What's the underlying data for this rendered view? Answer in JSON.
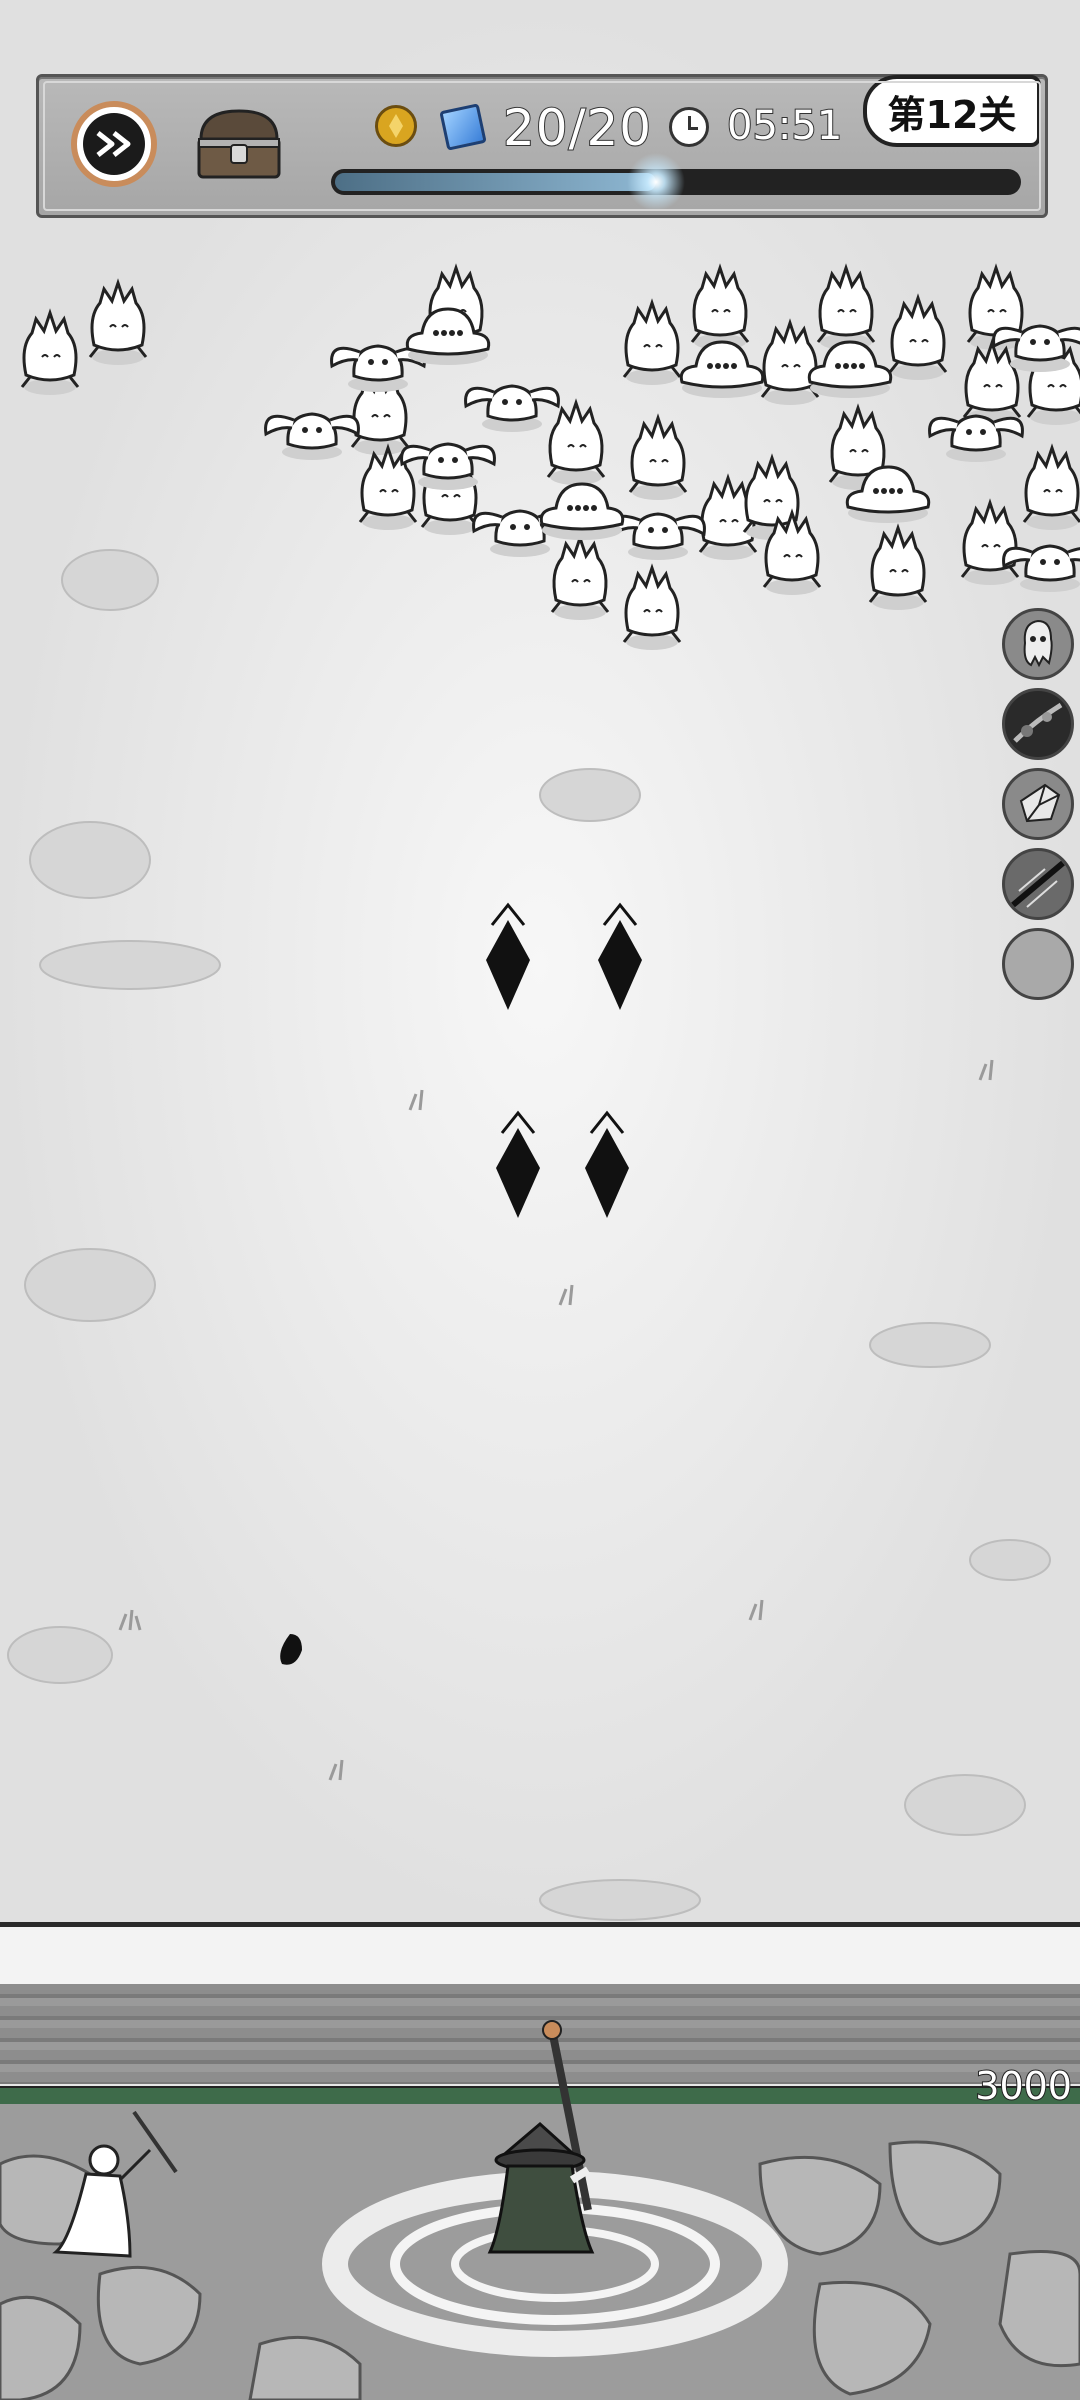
{
  "hud": {
    "energy": "20/20",
    "timer": "05:51",
    "level": "第12关",
    "wave_progress": 0.47
  },
  "wall": {
    "hp": "3000"
  },
  "icons": {
    "fast_forward": "fast-forward-icon",
    "chest": "treasure-chest-icon",
    "coin": "gold-coin-icon",
    "gem": "blue-gem-icon",
    "clock": "clock-icon"
  },
  "skills": [
    {
      "name": "ghost-skill-icon"
    },
    {
      "name": "dark-burst-skill-icon"
    },
    {
      "name": "crystal-skill-icon"
    },
    {
      "name": "wind-slash-skill-icon"
    },
    {
      "name": "empty-skill-slot"
    }
  ],
  "colors": {
    "hud_bg": "#aeaeae",
    "fast_forward_ring": "#c98c5b",
    "progress_fill": "#8fb8d3",
    "hp_bar": "#3e6b4a"
  }
}
